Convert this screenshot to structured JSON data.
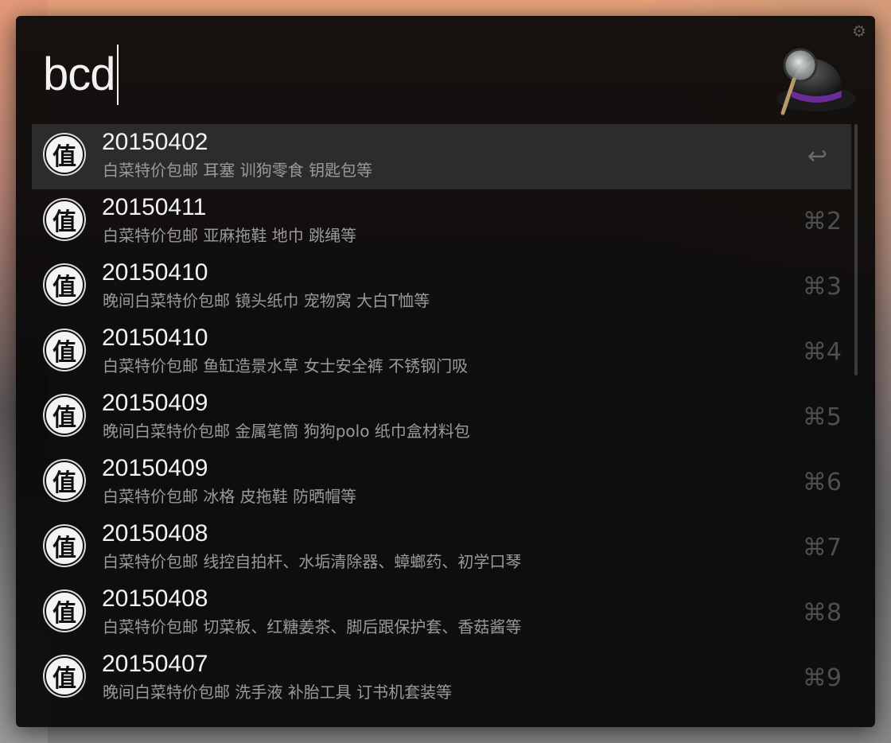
{
  "search": {
    "query": "bcd"
  },
  "icons": {
    "app_logo": "alfred-hat-icon",
    "settings": "gear-icon",
    "result_icon_glyph": "值"
  },
  "colors": {
    "panel": "#060606",
    "selected_row": "#2c2c2c",
    "title": "#f3f3f3",
    "subtitle": "#9a9a9a"
  },
  "results": [
    {
      "title": "20150402",
      "subtitle": "白菜特价包邮 耳塞 训狗零食 钥匙包等",
      "shortcut": "↩"
    },
    {
      "title": "20150411",
      "subtitle": "白菜特价包邮 亚麻拖鞋 地巾 跳绳等",
      "shortcut": "⌘2"
    },
    {
      "title": "20150410",
      "subtitle": "晚间白菜特价包邮 镜头纸巾 宠物窝 大白T恤等",
      "shortcut": "⌘3"
    },
    {
      "title": "20150410",
      "subtitle": "白菜特价包邮 鱼缸造景水草 女士安全裤 不锈钢门吸",
      "shortcut": "⌘4"
    },
    {
      "title": "20150409",
      "subtitle": "晚间白菜特价包邮 金属笔筒 狗狗polo 纸巾盒材料包",
      "shortcut": "⌘5"
    },
    {
      "title": "20150409",
      "subtitle": "白菜特价包邮 冰格 皮拖鞋 防晒帽等",
      "shortcut": "⌘6"
    },
    {
      "title": "20150408",
      "subtitle": "白菜特价包邮 线控自拍杆、水垢清除器、蟑螂药、初学口琴",
      "shortcut": "⌘7"
    },
    {
      "title": "20150408",
      "subtitle": "白菜特价包邮 切菜板、红糖姜茶、脚后跟保护套、香菇酱等",
      "shortcut": "⌘8"
    },
    {
      "title": "20150407",
      "subtitle": "晚间白菜特价包邮 洗手液 补胎工具 订书机套装等",
      "shortcut": "⌘9"
    }
  ]
}
